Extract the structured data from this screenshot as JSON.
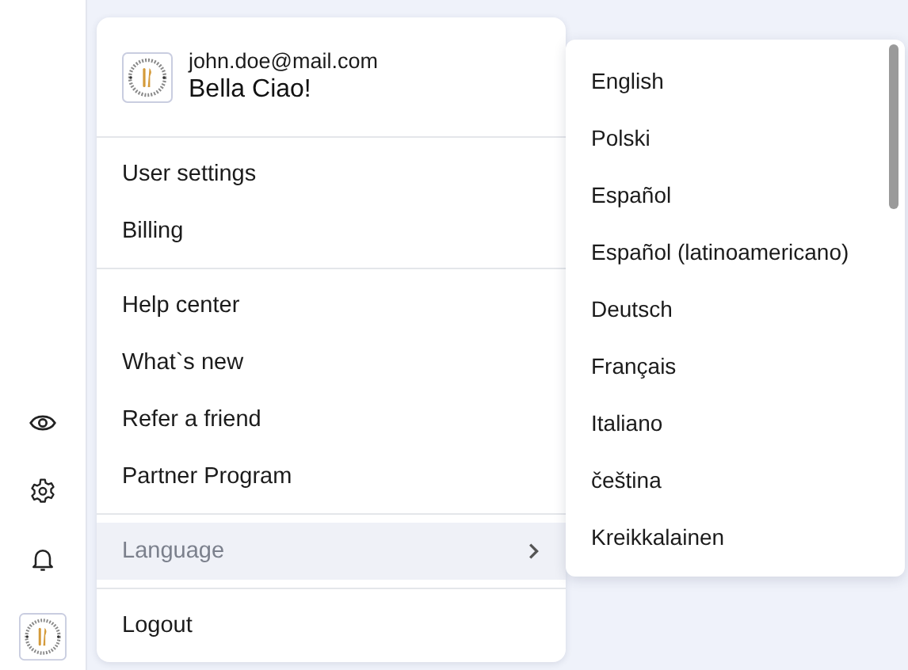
{
  "sidebar": {
    "icons": [
      {
        "kind": "eye"
      },
      {
        "kind": "gear"
      },
      {
        "kind": "bell"
      },
      {
        "kind": "avatar"
      }
    ]
  },
  "account": {
    "email": "john.doe@mail.com",
    "name": "Bella Ciao!"
  },
  "menu_groups": [
    [
      {
        "label": "User settings"
      },
      {
        "label": "Billing"
      }
    ],
    [
      {
        "label": "Help center"
      },
      {
        "label": "What`s new"
      },
      {
        "label": "Refer a friend"
      },
      {
        "label": "Partner Program"
      }
    ],
    [
      {
        "label": "Language",
        "submenu": true,
        "expanded": true
      }
    ],
    [
      {
        "label": "Logout"
      }
    ]
  ],
  "language_menu": {
    "items": [
      "English",
      "Polski",
      "Español",
      "Español (latinoamericano)",
      "Deutsch",
      "Français",
      "Italiano",
      "čeština",
      "Kreikkalainen"
    ]
  }
}
